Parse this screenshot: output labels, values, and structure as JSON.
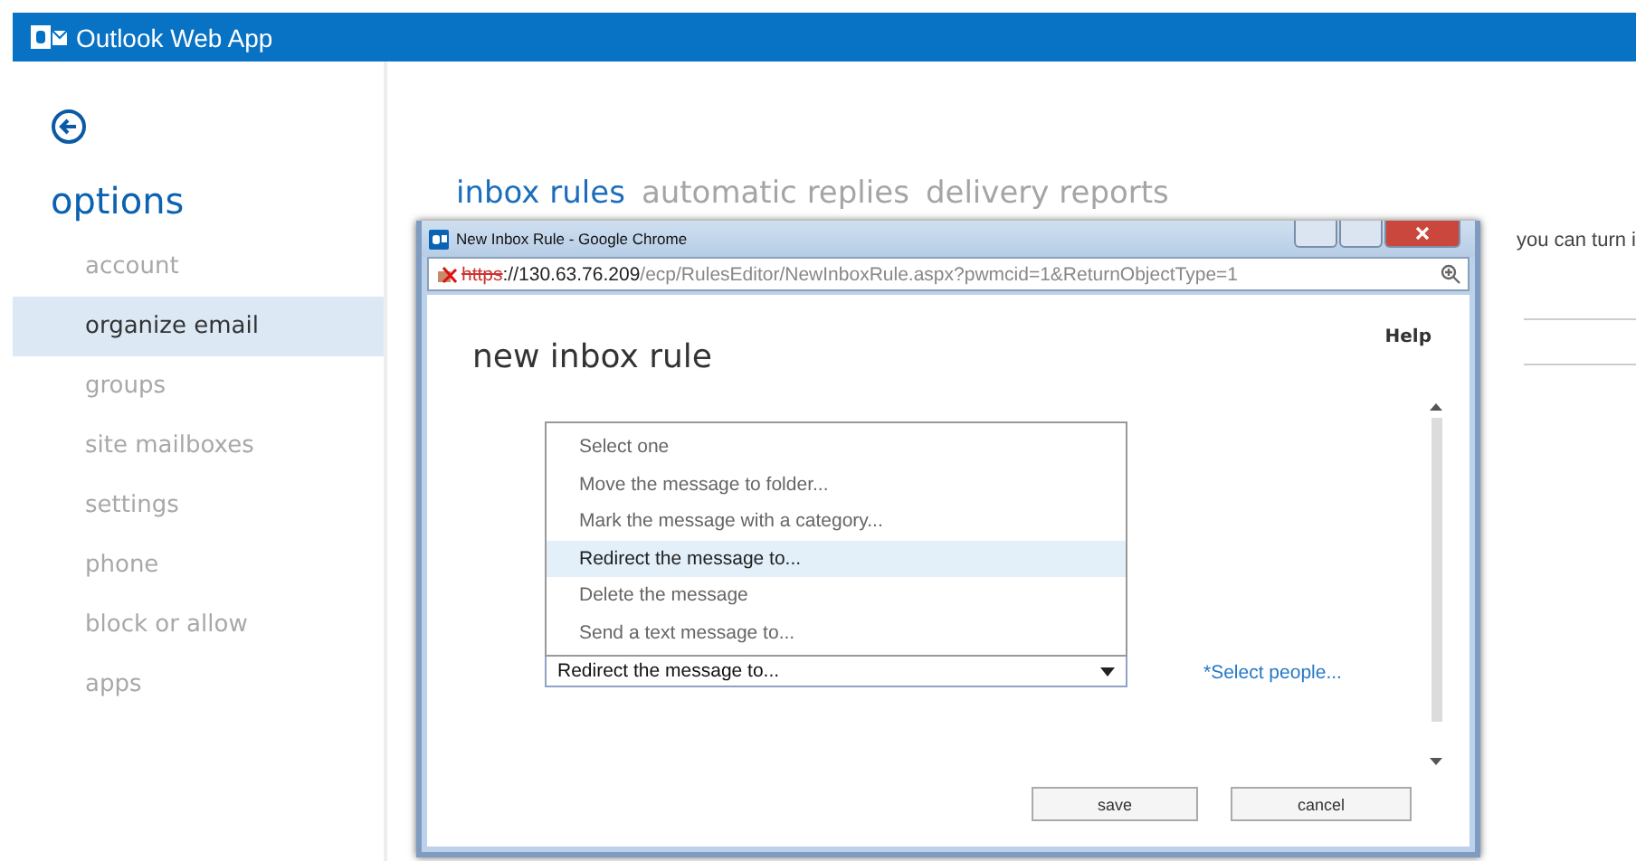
{
  "app_bar": {
    "title": "Outlook Web App"
  },
  "sidebar": {
    "heading": "options",
    "items": [
      {
        "label": "account",
        "selected": false
      },
      {
        "label": "organize email",
        "selected": true
      },
      {
        "label": "groups",
        "selected": false
      },
      {
        "label": "site mailboxes",
        "selected": false
      },
      {
        "label": "settings",
        "selected": false
      },
      {
        "label": "phone",
        "selected": false
      },
      {
        "label": "block or allow",
        "selected": false
      },
      {
        "label": "apps",
        "selected": false
      }
    ]
  },
  "tabs": [
    {
      "label": "inbox rules",
      "selected": true
    },
    {
      "label": "automatic replies",
      "selected": false
    },
    {
      "label": "delivery reports",
      "selected": false
    }
  ],
  "background_text": "you can turn i",
  "popup": {
    "title": "New Inbox Rule - Google Chrome",
    "address": {
      "scheme": "https",
      "host": "://130.63.76.209",
      "path": "/ecp/RulesEditor/NewInboxRule.aspx?pwmcid=1&ReturnObjectType=1"
    },
    "heading": "new inbox rule",
    "help": "Help",
    "dropdown": {
      "value": "Redirect the message to...",
      "expanded": true,
      "options": [
        {
          "label": "Select one",
          "selected": false
        },
        {
          "label": "Move the message to folder...",
          "selected": false
        },
        {
          "label": "Mark the message with a category...",
          "selected": false
        },
        {
          "label": "Redirect the message to...",
          "selected": true
        },
        {
          "label": "Delete the message",
          "selected": false
        },
        {
          "label": "Send a text message to...",
          "selected": false
        }
      ]
    },
    "link": "*Select people...",
    "buttons": [
      "save",
      "cancel"
    ]
  }
}
